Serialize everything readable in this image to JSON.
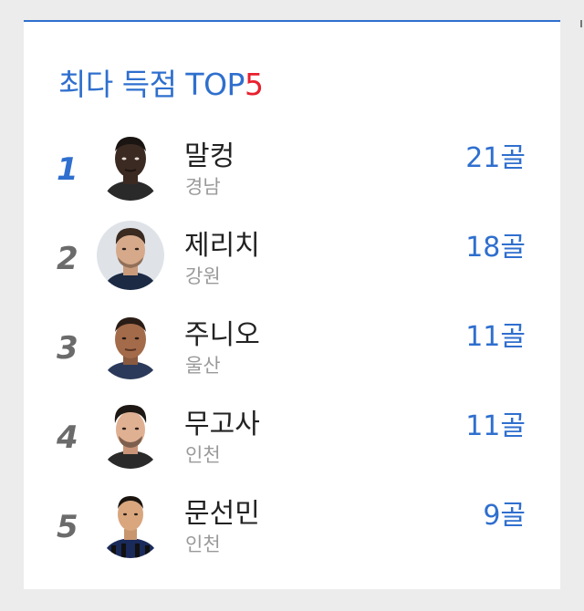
{
  "widget": {
    "title_main": "최다 득점 TOP",
    "title_highlight": "5",
    "accent_color": "#2f6fce",
    "highlight_color": "#e8202e"
  },
  "players": [
    {
      "rank": "1",
      "name": "말컹",
      "team": "경남",
      "goals": "21골",
      "avatar_icon": "player-photo-icon"
    },
    {
      "rank": "2",
      "name": "제리치",
      "team": "강원",
      "goals": "18골",
      "avatar_icon": "player-photo-icon"
    },
    {
      "rank": "3",
      "name": "주니오",
      "team": "울산",
      "goals": "11골",
      "avatar_icon": "player-photo-icon"
    },
    {
      "rank": "4",
      "name": "무고사",
      "team": "인천",
      "goals": "11골",
      "avatar_icon": "player-photo-icon"
    },
    {
      "rank": "5",
      "name": "문선민",
      "team": "인천",
      "goals": "9골",
      "avatar_icon": "player-photo-icon"
    }
  ]
}
